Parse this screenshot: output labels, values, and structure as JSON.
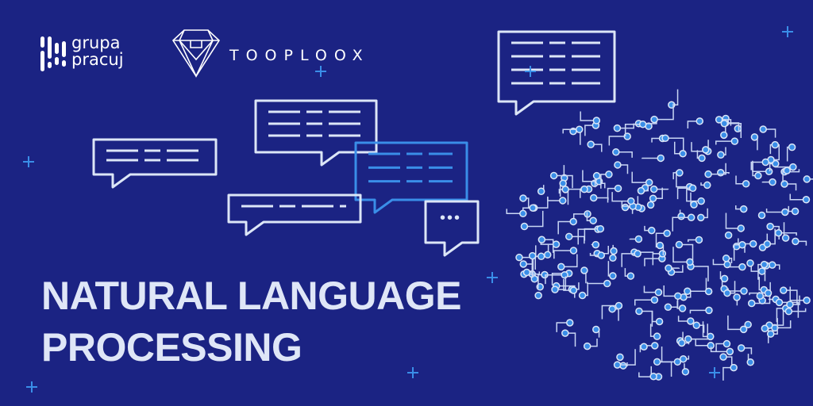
{
  "logos": {
    "grupa_pracuj": {
      "line1": "grupa",
      "line2": "pracuj"
    },
    "tooploox": "TOOPLOOX"
  },
  "headline": {
    "line1": "NATURAL LANGUAGE",
    "line2": "PROCESSING"
  },
  "typing_indicator": "•••",
  "colors": {
    "background": "#1b2383",
    "title": "#dfe6f7",
    "bubble": "#dce6f7",
    "accent": "#3a8ee8"
  }
}
